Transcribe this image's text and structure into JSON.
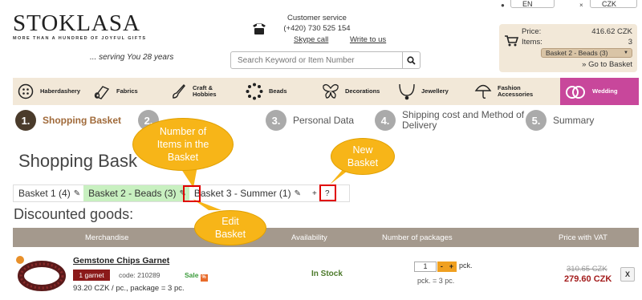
{
  "header": {
    "logo_text": "STOKLASA",
    "logo_tagline": "MORE THAN A HUNDRED OF JOYFUL GIFTS",
    "serving": "... serving You 28 years",
    "service_title": "Customer service",
    "service_phone": "(+420) 730 525 154",
    "skype_link": "Skype call",
    "write_link": "Write to us",
    "search_placeholder": "Search Keyword or Item Number",
    "lang_value": "EN",
    "currency_value": "CZK"
  },
  "cart": {
    "price_label": "Price:",
    "price_value": "416.62 CZK",
    "items_label": "Items:",
    "items_value": "3",
    "selected_basket": "Basket 2 - Beads (3)",
    "go_label": "» Go to Basket"
  },
  "nav": {
    "items": [
      {
        "label": "Haberdashery"
      },
      {
        "label": "Fabrics"
      },
      {
        "label": "Craft & Hobbies"
      },
      {
        "label": "Beads"
      },
      {
        "label": "Decorations"
      },
      {
        "label": "Jewellery"
      },
      {
        "label": "Fashion Accessories"
      },
      {
        "label": "Wedding"
      }
    ]
  },
  "steps": [
    {
      "num": "1.",
      "label": "Shopping Basket"
    },
    {
      "num": "2.",
      "label": ""
    },
    {
      "num": "3.",
      "label": "Personal Data"
    },
    {
      "num": "4.",
      "label": "Shipping cost and Method of Delivery"
    },
    {
      "num": "5.",
      "label": "Summary"
    }
  ],
  "main": {
    "title": "Shopping Bask",
    "tabs": [
      {
        "label": "Basket 1 (4)"
      },
      {
        "label": "Basket 2 - Beads (3)"
      },
      {
        "label": "Basket 3 - Summer (1)"
      }
    ],
    "add_tab": "+",
    "help": "?",
    "section_title": "Discounted goods:",
    "columns": {
      "merchandise": "Merchandise",
      "availability": "Availability",
      "packages": "Number of packages",
      "price": "Price with VAT"
    }
  },
  "product": {
    "name": "Gemstone Chips Garnet",
    "badge": "1 garnet",
    "code": "code: 210289",
    "sale": "Sale",
    "package_text": "93.20 CZK / pc., package = 3 pc.",
    "availability": "In Stock",
    "quantity": "1",
    "qty_unit": "pck.",
    "qty_note": "pck. = 3 pc.",
    "price_old": "310.65 CZK",
    "price_new": "279.60 CZK",
    "remove_label": "X"
  },
  "annotations": {
    "items_callout": "Number of Items in the Basket",
    "new_basket_callout": "New Basket",
    "edit_callout": "Edit Basket"
  },
  "colors": {
    "nav_bg": "#f2e8d8",
    "wedding_bg": "#c8479b",
    "active_tab": "#c8f0c0",
    "callout": "#f7b518",
    "highlight": "#e00000"
  }
}
